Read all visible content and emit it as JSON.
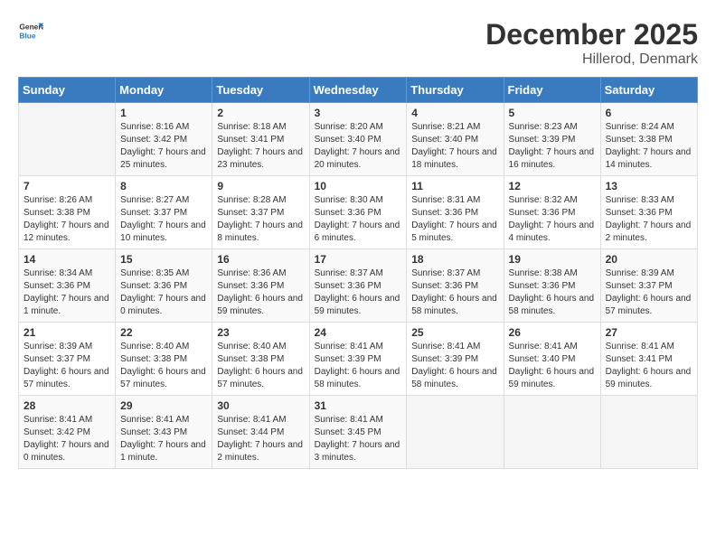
{
  "logo": {
    "general": "General",
    "blue": "Blue"
  },
  "header": {
    "title": "December 2025",
    "subtitle": "Hillerod, Denmark"
  },
  "days_of_week": [
    "Sunday",
    "Monday",
    "Tuesday",
    "Wednesday",
    "Thursday",
    "Friday",
    "Saturday"
  ],
  "weeks": [
    [
      {
        "day": "",
        "sunrise": "",
        "sunset": "",
        "daylight": ""
      },
      {
        "day": "1",
        "sunrise": "Sunrise: 8:16 AM",
        "sunset": "Sunset: 3:42 PM",
        "daylight": "Daylight: 7 hours and 25 minutes."
      },
      {
        "day": "2",
        "sunrise": "Sunrise: 8:18 AM",
        "sunset": "Sunset: 3:41 PM",
        "daylight": "Daylight: 7 hours and 23 minutes."
      },
      {
        "day": "3",
        "sunrise": "Sunrise: 8:20 AM",
        "sunset": "Sunset: 3:40 PM",
        "daylight": "Daylight: 7 hours and 20 minutes."
      },
      {
        "day": "4",
        "sunrise": "Sunrise: 8:21 AM",
        "sunset": "Sunset: 3:40 PM",
        "daylight": "Daylight: 7 hours and 18 minutes."
      },
      {
        "day": "5",
        "sunrise": "Sunrise: 8:23 AM",
        "sunset": "Sunset: 3:39 PM",
        "daylight": "Daylight: 7 hours and 16 minutes."
      },
      {
        "day": "6",
        "sunrise": "Sunrise: 8:24 AM",
        "sunset": "Sunset: 3:38 PM",
        "daylight": "Daylight: 7 hours and 14 minutes."
      }
    ],
    [
      {
        "day": "7",
        "sunrise": "Sunrise: 8:26 AM",
        "sunset": "Sunset: 3:38 PM",
        "daylight": "Daylight: 7 hours and 12 minutes."
      },
      {
        "day": "8",
        "sunrise": "Sunrise: 8:27 AM",
        "sunset": "Sunset: 3:37 PM",
        "daylight": "Daylight: 7 hours and 10 minutes."
      },
      {
        "day": "9",
        "sunrise": "Sunrise: 8:28 AM",
        "sunset": "Sunset: 3:37 PM",
        "daylight": "Daylight: 7 hours and 8 minutes."
      },
      {
        "day": "10",
        "sunrise": "Sunrise: 8:30 AM",
        "sunset": "Sunset: 3:36 PM",
        "daylight": "Daylight: 7 hours and 6 minutes."
      },
      {
        "day": "11",
        "sunrise": "Sunrise: 8:31 AM",
        "sunset": "Sunset: 3:36 PM",
        "daylight": "Daylight: 7 hours and 5 minutes."
      },
      {
        "day": "12",
        "sunrise": "Sunrise: 8:32 AM",
        "sunset": "Sunset: 3:36 PM",
        "daylight": "Daylight: 7 hours and 4 minutes."
      },
      {
        "day": "13",
        "sunrise": "Sunrise: 8:33 AM",
        "sunset": "Sunset: 3:36 PM",
        "daylight": "Daylight: 7 hours and 2 minutes."
      }
    ],
    [
      {
        "day": "14",
        "sunrise": "Sunrise: 8:34 AM",
        "sunset": "Sunset: 3:36 PM",
        "daylight": "Daylight: 7 hours and 1 minute."
      },
      {
        "day": "15",
        "sunrise": "Sunrise: 8:35 AM",
        "sunset": "Sunset: 3:36 PM",
        "daylight": "Daylight: 7 hours and 0 minutes."
      },
      {
        "day": "16",
        "sunrise": "Sunrise: 8:36 AM",
        "sunset": "Sunset: 3:36 PM",
        "daylight": "Daylight: 6 hours and 59 minutes."
      },
      {
        "day": "17",
        "sunrise": "Sunrise: 8:37 AM",
        "sunset": "Sunset: 3:36 PM",
        "daylight": "Daylight: 6 hours and 59 minutes."
      },
      {
        "day": "18",
        "sunrise": "Sunrise: 8:37 AM",
        "sunset": "Sunset: 3:36 PM",
        "daylight": "Daylight: 6 hours and 58 minutes."
      },
      {
        "day": "19",
        "sunrise": "Sunrise: 8:38 AM",
        "sunset": "Sunset: 3:36 PM",
        "daylight": "Daylight: 6 hours and 58 minutes."
      },
      {
        "day": "20",
        "sunrise": "Sunrise: 8:39 AM",
        "sunset": "Sunset: 3:37 PM",
        "daylight": "Daylight: 6 hours and 57 minutes."
      }
    ],
    [
      {
        "day": "21",
        "sunrise": "Sunrise: 8:39 AM",
        "sunset": "Sunset: 3:37 PM",
        "daylight": "Daylight: 6 hours and 57 minutes."
      },
      {
        "day": "22",
        "sunrise": "Sunrise: 8:40 AM",
        "sunset": "Sunset: 3:38 PM",
        "daylight": "Daylight: 6 hours and 57 minutes."
      },
      {
        "day": "23",
        "sunrise": "Sunrise: 8:40 AM",
        "sunset": "Sunset: 3:38 PM",
        "daylight": "Daylight: 6 hours and 57 minutes."
      },
      {
        "day": "24",
        "sunrise": "Sunrise: 8:41 AM",
        "sunset": "Sunset: 3:39 PM",
        "daylight": "Daylight: 6 hours and 58 minutes."
      },
      {
        "day": "25",
        "sunrise": "Sunrise: 8:41 AM",
        "sunset": "Sunset: 3:39 PM",
        "daylight": "Daylight: 6 hours and 58 minutes."
      },
      {
        "day": "26",
        "sunrise": "Sunrise: 8:41 AM",
        "sunset": "Sunset: 3:40 PM",
        "daylight": "Daylight: 6 hours and 59 minutes."
      },
      {
        "day": "27",
        "sunrise": "Sunrise: 8:41 AM",
        "sunset": "Sunset: 3:41 PM",
        "daylight": "Daylight: 6 hours and 59 minutes."
      }
    ],
    [
      {
        "day": "28",
        "sunrise": "Sunrise: 8:41 AM",
        "sunset": "Sunset: 3:42 PM",
        "daylight": "Daylight: 7 hours and 0 minutes."
      },
      {
        "day": "29",
        "sunrise": "Sunrise: 8:41 AM",
        "sunset": "Sunset: 3:43 PM",
        "daylight": "Daylight: 7 hours and 1 minute."
      },
      {
        "day": "30",
        "sunrise": "Sunrise: 8:41 AM",
        "sunset": "Sunset: 3:44 PM",
        "daylight": "Daylight: 7 hours and 2 minutes."
      },
      {
        "day": "31",
        "sunrise": "Sunrise: 8:41 AM",
        "sunset": "Sunset: 3:45 PM",
        "daylight": "Daylight: 7 hours and 3 minutes."
      },
      {
        "day": "",
        "sunrise": "",
        "sunset": "",
        "daylight": ""
      },
      {
        "day": "",
        "sunrise": "",
        "sunset": "",
        "daylight": ""
      },
      {
        "day": "",
        "sunrise": "",
        "sunset": "",
        "daylight": ""
      }
    ]
  ]
}
